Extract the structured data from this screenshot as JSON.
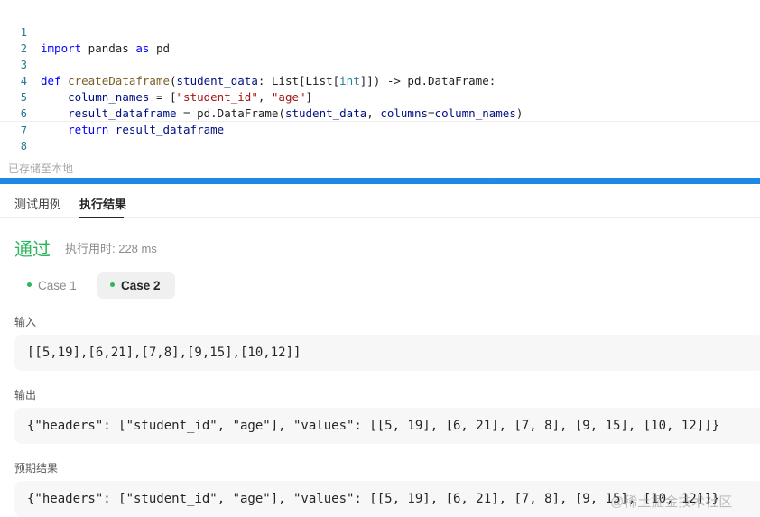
{
  "editor": {
    "lines": [
      {
        "num": "1",
        "code": "import pandas as pd"
      },
      {
        "num": "2",
        "code": ""
      },
      {
        "num": "3",
        "code": "def createDataframe(student_data: List[List[int]]) -> pd.DataFrame:"
      },
      {
        "num": "4",
        "code": "    column_names = [\"student_id\", \"age\"]"
      },
      {
        "num": "5",
        "code": "    result_dataframe = pd.DataFrame(student_data, columns=column_names)"
      },
      {
        "num": "6",
        "code": "    return result_dataframe"
      },
      {
        "num": "7",
        "code": ""
      },
      {
        "num": "8",
        "code": ""
      }
    ]
  },
  "status": {
    "saved": "已存储至本地"
  },
  "tabs": {
    "test_cases": "测试用例",
    "results": "执行结果"
  },
  "result": {
    "status": "通过",
    "runtime": "执行用时: 228 ms"
  },
  "cases": [
    {
      "label": "Case 1"
    },
    {
      "label": "Case 2"
    }
  ],
  "sections": {
    "input_label": "输入",
    "input_value": "[[5,19],[6,21],[7,8],[9,15],[10,12]]",
    "output_label": "输出",
    "output_value": "{\"headers\": [\"student_id\", \"age\"], \"values\": [[5, 19], [6, 21], [7, 8], [9, 15], [10, 12]]}",
    "expected_label": "预期结果",
    "expected_value": "{\"headers\": [\"student_id\", \"age\"], \"values\": [[5, 19], [6, 21], [7, 8], [9, 15], [10, 12]]}"
  },
  "watermark": "@稀土掘金技术社区",
  "colors": {
    "accent": "#1e88e5",
    "pass": "#2db55d"
  }
}
